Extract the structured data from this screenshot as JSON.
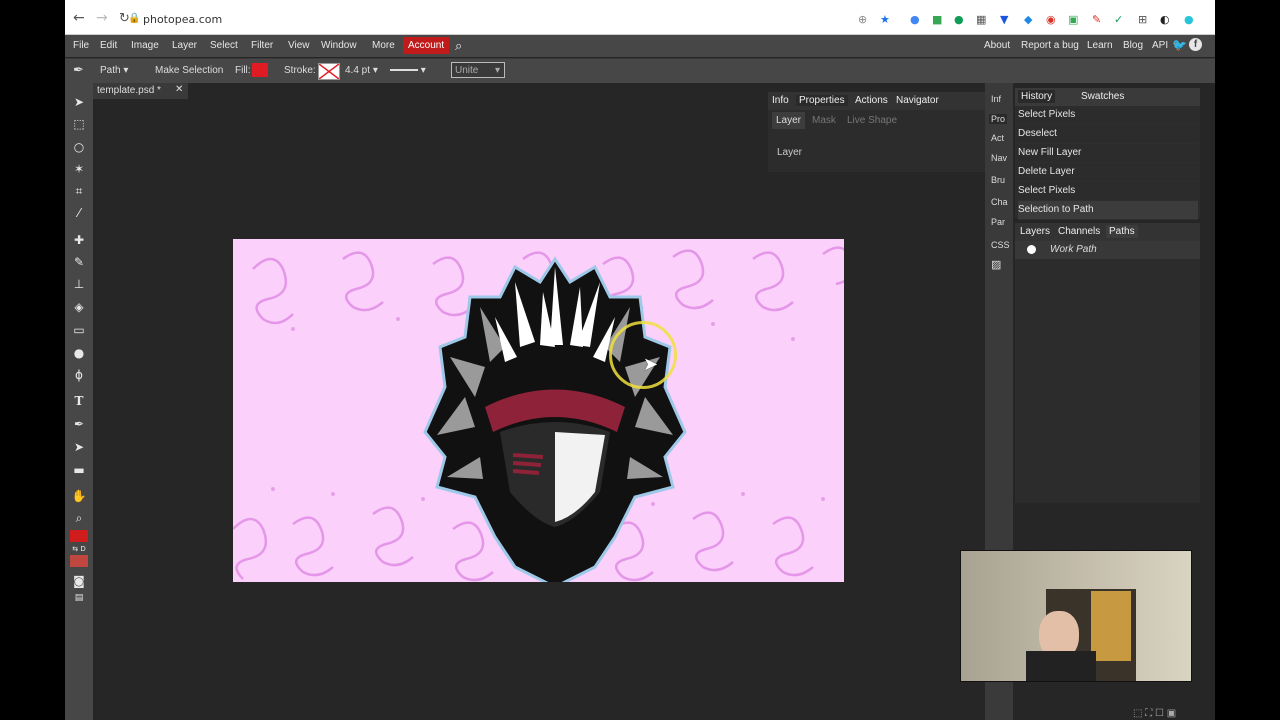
{
  "browser": {
    "url": "photopea.com",
    "back_icon": "back-arrow-icon",
    "forward_icon": "forward-arrow-icon",
    "reload_icon": "reload-icon"
  },
  "menu": {
    "items": [
      "File",
      "Edit",
      "Image",
      "Layer",
      "Select",
      "Filter",
      "View",
      "Window",
      "More"
    ],
    "account": "Account",
    "right_links": [
      "About",
      "Report a bug",
      "Learn",
      "Blog",
      "API"
    ]
  },
  "options": {
    "mode": "Path",
    "make_selection": "Make Selection",
    "fill_label": "Fill:",
    "stroke_label": "Stroke:",
    "stroke_width": "4.4 pt",
    "combine": "Unite"
  },
  "document": {
    "tab_title": "template.psd *"
  },
  "properties_panel": {
    "tabs": [
      "Info",
      "Properties",
      "Actions",
      "Navigator"
    ],
    "subtabs": [
      "Layer",
      "Mask",
      "Live Shape"
    ],
    "content": "Layer"
  },
  "right_strip": [
    "Inf",
    "Pro",
    "Act",
    "Nav",
    "Bru",
    "Cha",
    "Par",
    "CSS"
  ],
  "history_panel": {
    "tabs": [
      "History",
      "Swatches"
    ],
    "items": [
      "Select Pixels",
      "Deselect",
      "New Fill Layer",
      "Delete Layer",
      "Select Pixels",
      "Selection to Path"
    ]
  },
  "layers_panel": {
    "tabs": [
      "Layers",
      "Channels",
      "Paths"
    ],
    "items": [
      "Work Path"
    ]
  },
  "colors": {
    "accent": "#c01a1a",
    "canvas_bg": "#fbd1fb",
    "fill": "#e01b24"
  }
}
